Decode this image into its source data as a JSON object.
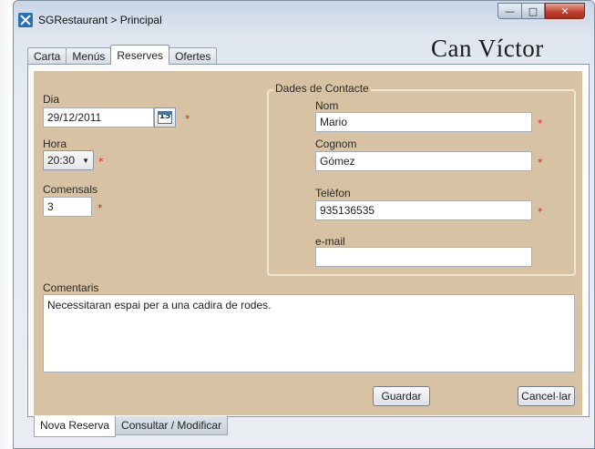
{
  "window": {
    "title": "SGRestaurant > Principal"
  },
  "brand": {
    "name": "Can Víctor"
  },
  "tabs": [
    {
      "label": "Carta"
    },
    {
      "label": "Menús"
    },
    {
      "label": "Reserves"
    },
    {
      "label": "Ofertes"
    }
  ],
  "active_tab": "Reserves",
  "form": {
    "dia": {
      "label": "Dia",
      "value": "29/12/2011",
      "calendar_day": "15",
      "required": "*"
    },
    "hora": {
      "label": "Hora",
      "value": "20:30",
      "required": "*"
    },
    "comensals": {
      "label": "Comensals",
      "value": "3",
      "required": "*"
    },
    "contact": {
      "legend": "Dades de Contacte",
      "nom": {
        "label": "Nom",
        "value": "Mario",
        "required": "*"
      },
      "cognom": {
        "label": "Cognom",
        "value": "Gómez",
        "required": "*"
      },
      "telefon": {
        "label": "Telèfon",
        "value": "935136535",
        "required": "*"
      },
      "email": {
        "label": "e-mail",
        "value": ""
      }
    },
    "comentaris": {
      "label": "Comentaris",
      "value": "Necessitaran espai per a una cadira de rodes."
    }
  },
  "buttons": {
    "save": "Guardar",
    "cancel": "Cancel·lar"
  },
  "bottom_tabs": [
    {
      "label": "Nova Reserva"
    },
    {
      "label": "Consultar / Modificar"
    }
  ],
  "colors": {
    "content_bg": "#d7c3a3",
    "required": "#d0281f"
  }
}
